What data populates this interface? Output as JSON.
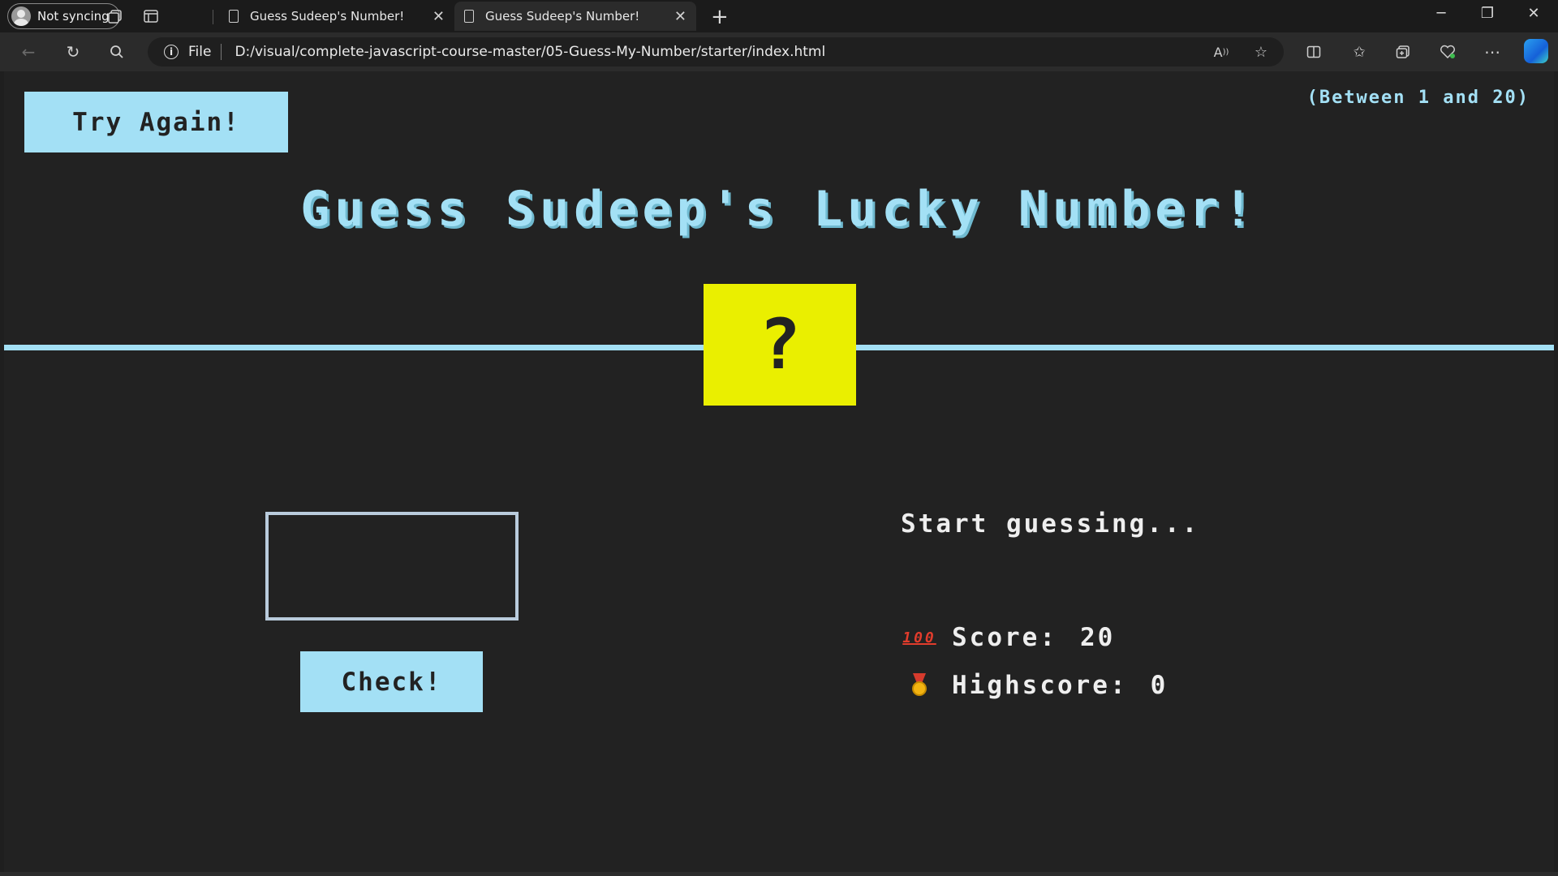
{
  "browser": {
    "profile_label": "Not syncing",
    "tabs": [
      {
        "title": "Guess Sudeep's Number!"
      },
      {
        "title": "Guess Sudeep's Number!"
      }
    ],
    "address": {
      "scheme_label": "File",
      "url": "D:/visual/complete-javascript-course-master/05-Guess-My-Number/starter/index.html"
    }
  },
  "game": {
    "again_label": "Try Again!",
    "range_text": "(Between 1 and 20)",
    "title": "Guess Sudeep's Lucky Number!",
    "secret_display": "?",
    "guess_value": "",
    "check_label": "Check!",
    "message": "Start guessing...",
    "score_label": "Score:",
    "score_value": "20",
    "highscore_label": "Highscore:",
    "highscore_value": "0",
    "score_icon": "hundred-points-emoji",
    "highscore_icon": "medal-emoji"
  },
  "colors": {
    "accent": "#a3e0f5",
    "number_box": "#eaef00",
    "page_bg": "#222222"
  }
}
